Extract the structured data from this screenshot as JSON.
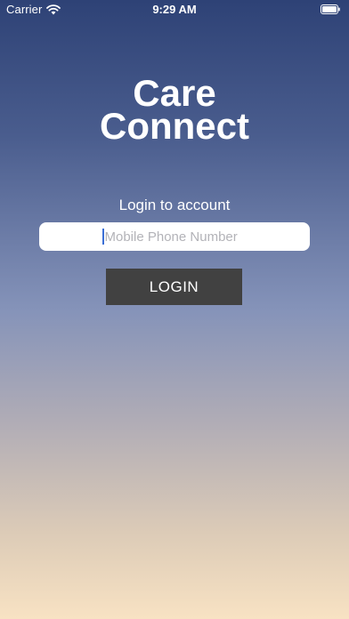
{
  "status_bar": {
    "carrier": "Carrier",
    "time": "9:29 AM",
    "wifi_icon": "wifi-icon",
    "battery_icon": "battery-full-icon"
  },
  "app": {
    "title_line1": "Care",
    "title_line2": "Connect"
  },
  "login": {
    "heading": "Login to account",
    "phone": {
      "placeholder": "Mobile Phone Number",
      "value": ""
    },
    "button_label": "LOGIN"
  },
  "colors": {
    "gradient_top": "#2e4276",
    "gradient_bottom": "#f8e2c3",
    "button_bg": "#414141",
    "field_bg": "#ffffff",
    "caret": "#3b6fd6"
  }
}
